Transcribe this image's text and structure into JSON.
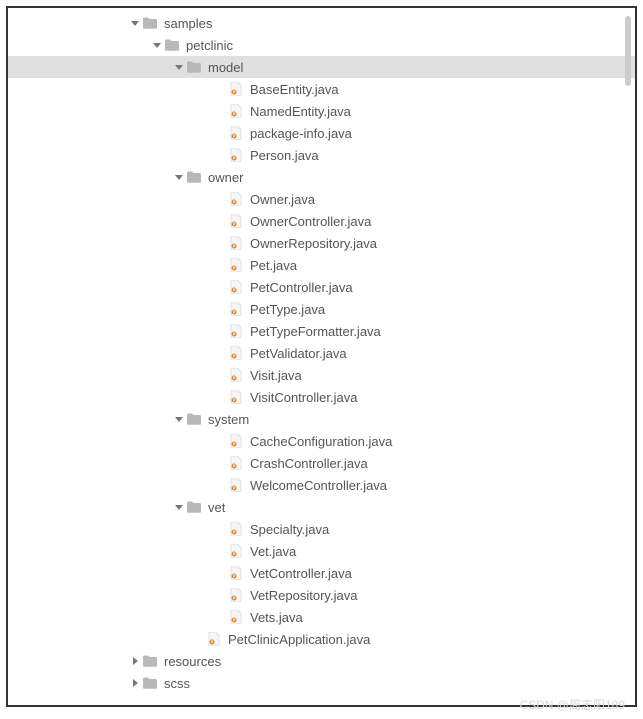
{
  "tree": [
    {
      "depth": 0,
      "type": "folder",
      "expanded": true,
      "selected": false,
      "name": "samples",
      "label": "samples"
    },
    {
      "depth": 1,
      "type": "folder",
      "expanded": true,
      "selected": false,
      "name": "petclinic",
      "label": "petclinic"
    },
    {
      "depth": 2,
      "type": "folder",
      "expanded": true,
      "selected": true,
      "name": "model",
      "label": "model"
    },
    {
      "depth": 3,
      "type": "java",
      "expanded": null,
      "selected": false,
      "name": "base-entity",
      "label": "BaseEntity.java"
    },
    {
      "depth": 3,
      "type": "java",
      "expanded": null,
      "selected": false,
      "name": "named-entity",
      "label": "NamedEntity.java"
    },
    {
      "depth": 3,
      "type": "java",
      "expanded": null,
      "selected": false,
      "name": "package-info",
      "label": "package-info.java"
    },
    {
      "depth": 3,
      "type": "java",
      "expanded": null,
      "selected": false,
      "name": "person",
      "label": "Person.java"
    },
    {
      "depth": 2,
      "type": "folder",
      "expanded": true,
      "selected": false,
      "name": "owner",
      "label": "owner"
    },
    {
      "depth": 3,
      "type": "java",
      "expanded": null,
      "selected": false,
      "name": "owner-file",
      "label": "Owner.java"
    },
    {
      "depth": 3,
      "type": "java",
      "expanded": null,
      "selected": false,
      "name": "owner-controller",
      "label": "OwnerController.java"
    },
    {
      "depth": 3,
      "type": "java",
      "expanded": null,
      "selected": false,
      "name": "owner-repository",
      "label": "OwnerRepository.java"
    },
    {
      "depth": 3,
      "type": "java",
      "expanded": null,
      "selected": false,
      "name": "pet",
      "label": "Pet.java"
    },
    {
      "depth": 3,
      "type": "java",
      "expanded": null,
      "selected": false,
      "name": "pet-controller",
      "label": "PetController.java"
    },
    {
      "depth": 3,
      "type": "java",
      "expanded": null,
      "selected": false,
      "name": "pet-type",
      "label": "PetType.java"
    },
    {
      "depth": 3,
      "type": "java",
      "expanded": null,
      "selected": false,
      "name": "pet-type-formatter",
      "label": "PetTypeFormatter.java"
    },
    {
      "depth": 3,
      "type": "java",
      "expanded": null,
      "selected": false,
      "name": "pet-validator",
      "label": "PetValidator.java"
    },
    {
      "depth": 3,
      "type": "java",
      "expanded": null,
      "selected": false,
      "name": "visit",
      "label": "Visit.java"
    },
    {
      "depth": 3,
      "type": "java",
      "expanded": null,
      "selected": false,
      "name": "visit-controller",
      "label": "VisitController.java"
    },
    {
      "depth": 2,
      "type": "folder",
      "expanded": true,
      "selected": false,
      "name": "system",
      "label": "system"
    },
    {
      "depth": 3,
      "type": "java",
      "expanded": null,
      "selected": false,
      "name": "cache-configuration",
      "label": "CacheConfiguration.java"
    },
    {
      "depth": 3,
      "type": "java",
      "expanded": null,
      "selected": false,
      "name": "crash-controller",
      "label": "CrashController.java"
    },
    {
      "depth": 3,
      "type": "java",
      "expanded": null,
      "selected": false,
      "name": "welcome-controller",
      "label": "WelcomeController.java"
    },
    {
      "depth": 2,
      "type": "folder",
      "expanded": true,
      "selected": false,
      "name": "vet",
      "label": "vet"
    },
    {
      "depth": 3,
      "type": "java",
      "expanded": null,
      "selected": false,
      "name": "specialty",
      "label": "Specialty.java"
    },
    {
      "depth": 3,
      "type": "java",
      "expanded": null,
      "selected": false,
      "name": "vet-file",
      "label": "Vet.java"
    },
    {
      "depth": 3,
      "type": "java",
      "expanded": null,
      "selected": false,
      "name": "vet-controller",
      "label": "VetController.java"
    },
    {
      "depth": 3,
      "type": "java",
      "expanded": null,
      "selected": false,
      "name": "vet-repository",
      "label": "VetRepository.java"
    },
    {
      "depth": 3,
      "type": "java",
      "expanded": null,
      "selected": false,
      "name": "vets",
      "label": "Vets.java"
    },
    {
      "depth": 2,
      "type": "java",
      "expanded": null,
      "selected": false,
      "name": "pet-clinic-application",
      "label": "PetClinicApplication.java"
    },
    {
      "depth": 0,
      "type": "folder",
      "expanded": false,
      "selected": false,
      "name": "resources",
      "label": "resources"
    },
    {
      "depth": 0,
      "type": "folder",
      "expanded": false,
      "selected": false,
      "name": "scss",
      "label": "scss"
    }
  ],
  "baseIndent": 120,
  "indentStep": 22,
  "watermark": "CSDN @周志阳189"
}
